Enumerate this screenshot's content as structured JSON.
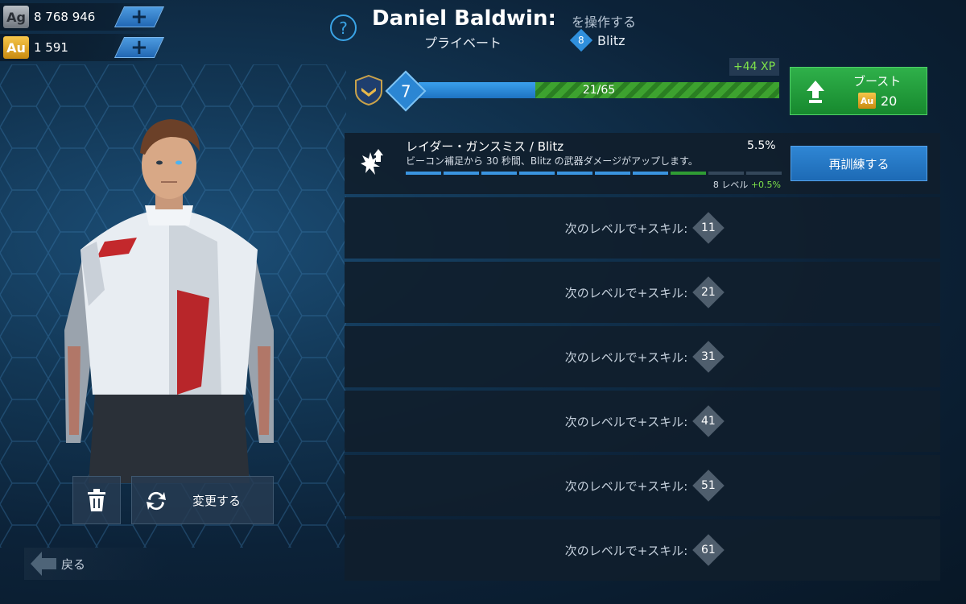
{
  "currencies": {
    "silver": {
      "label": "Ag",
      "value": "8 768 946"
    },
    "gold": {
      "label": "Au",
      "value": "1 591"
    }
  },
  "header": {
    "help_symbol": "?",
    "character_name": "Daniel Baldwin:",
    "operate_label": "を操作する",
    "rank": "プライベート",
    "class_level": "8",
    "class_name": "Blitz"
  },
  "xp": {
    "level": "7",
    "gain": "+44 XP",
    "progress_text": "21/65",
    "current": 21,
    "max": 65
  },
  "boost": {
    "label": "ブースト",
    "currency_label": "Au",
    "cost": "20"
  },
  "skill": {
    "name": "レイダー・ガンスミス / Blitz",
    "percent": "5.5%",
    "description": "ビーコン補足から 30 秒間、Blitz の武器ダメージがアップします。",
    "level_text": "8 レベル",
    "level_bonus": "+0.5%",
    "retrain_label": "再訓練する"
  },
  "next_levels": [
    {
      "label": "次のレベルで+スキル:",
      "level": "11"
    },
    {
      "label": "次のレベルで+スキル:",
      "level": "21"
    },
    {
      "label": "次のレベルで+スキル:",
      "level": "31"
    },
    {
      "label": "次のレベルで+スキル:",
      "level": "41"
    },
    {
      "label": "次のレベルで+スキル:",
      "level": "51"
    },
    {
      "label": "次のレベルで+スキル:",
      "level": "61"
    }
  ],
  "actions": {
    "change_label": "変更する",
    "back_label": "戻る"
  },
  "colors": {
    "accent_blue": "#2b86d3",
    "boost_green": "#2fb04a",
    "xp_gain_green": "#7ee34a"
  }
}
